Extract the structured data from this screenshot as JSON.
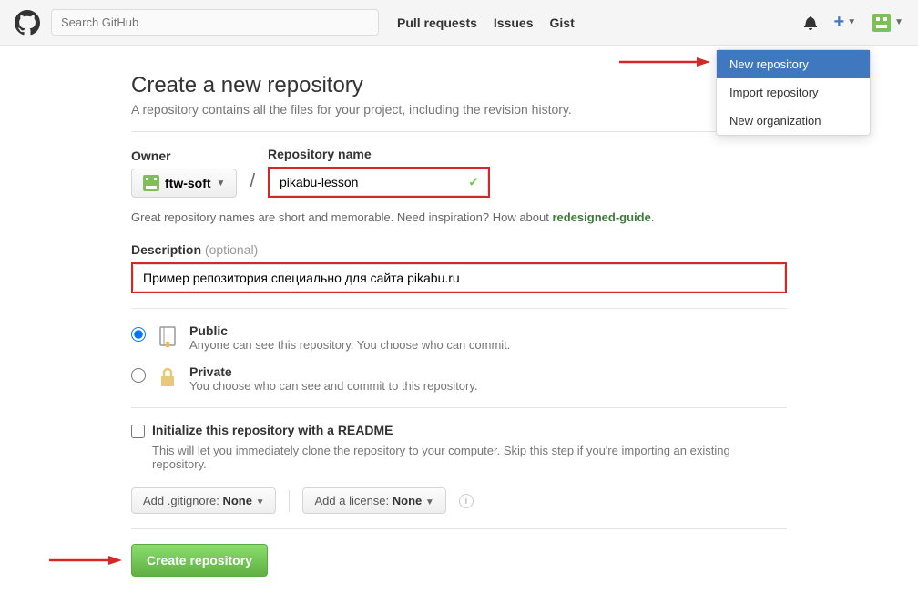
{
  "header": {
    "search_placeholder": "Search GitHub",
    "links": [
      "Pull requests",
      "Issues",
      "Gist"
    ]
  },
  "dropdown": {
    "items": [
      {
        "label": "New repository",
        "selected": true
      },
      {
        "label": "Import repository",
        "selected": false
      },
      {
        "label": "New organization",
        "selected": false
      }
    ]
  },
  "page": {
    "title": "Create a new repository",
    "subtitle": "A repository contains all the files for your project, including the revision history."
  },
  "form": {
    "owner_label": "Owner",
    "owner_value": "ftw-soft",
    "repo_label": "Repository name",
    "repo_value": "pikabu-lesson",
    "hint_text": "Great repository names are short and memorable. Need inspiration? How about ",
    "hint_suggestion": "redesigned-guide",
    "desc_label": "Description",
    "desc_optional": "(optional)",
    "desc_value": "Пример репозитория специально для сайта pikabu.ru",
    "public_title": "Public",
    "public_desc": "Anyone can see this repository. You choose who can commit.",
    "private_title": "Private",
    "private_desc": "You choose who can see and commit to this repository.",
    "init_title": "Initialize this repository with a README",
    "init_desc": "This will let you immediately clone the repository to your computer. Skip this step if you're importing an existing repository.",
    "gitignore_prefix": "Add .gitignore: ",
    "gitignore_value": "None",
    "license_prefix": "Add a license: ",
    "license_value": "None",
    "submit_label": "Create repository"
  }
}
